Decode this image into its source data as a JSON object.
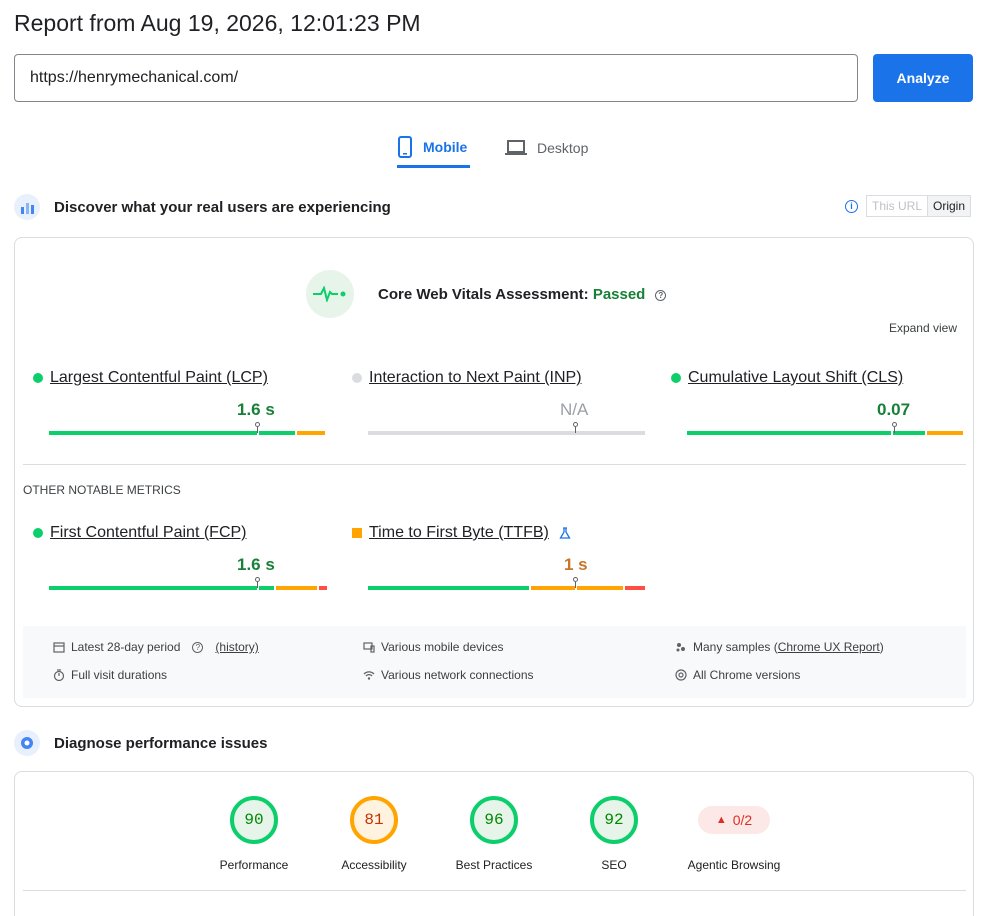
{
  "report_title": "Report from Aug 19, 2026, 12:01:23 PM",
  "url_input": {
    "value": "https://henrymechanical.com/"
  },
  "analyze_label": "Analyze",
  "tabs": [
    {
      "label": "Mobile",
      "active": true
    },
    {
      "label": "Desktop",
      "active": false
    }
  ],
  "field": {
    "heading": "Discover what your real users are experiencing",
    "toggle": {
      "this_url": "This URL",
      "origin": "Origin",
      "selected": "Origin"
    },
    "assessment_prefix": "Core Web Vitals Assessment:",
    "assessment_status": "Passed",
    "expand_view": "Expand view",
    "metrics": [
      {
        "name": "Largest Contentful Paint (LCP)",
        "value": "1.6 s",
        "status": "good"
      },
      {
        "name": "Interaction to Next Paint (INP)",
        "value": "N/A",
        "status": "none"
      },
      {
        "name": "Cumulative Layout Shift (CLS)",
        "value": "0.07",
        "status": "good"
      }
    ],
    "other_label": "OTHER NOTABLE METRICS",
    "other_metrics": [
      {
        "name": "First Contentful Paint (FCP)",
        "value": "1.6 s",
        "status": "good"
      },
      {
        "name": "Time to First Byte (TTFB)",
        "value": "1 s",
        "status": "average"
      }
    ],
    "info": {
      "period": "Latest 28-day period",
      "history": "(history)",
      "devices": "Various mobile devices",
      "samples_prefix": "Many samples (",
      "samples_link": "Chrome UX Report",
      "samples_suffix": ")",
      "durations": "Full visit durations",
      "network": "Various network connections",
      "chrome": "All Chrome versions"
    }
  },
  "diagnose": {
    "heading": "Diagnose performance issues",
    "scores": [
      {
        "label": "Performance",
        "value": "90",
        "level": "green"
      },
      {
        "label": "Accessibility",
        "value": "81",
        "level": "orange"
      },
      {
        "label": "Best Practices",
        "value": "96",
        "level": "green"
      },
      {
        "label": "SEO",
        "value": "92",
        "level": "green"
      },
      {
        "label": "Agentic Browsing",
        "value": "0/2",
        "level": "fail"
      }
    ]
  },
  "colors": {
    "accent": "#1a73e8",
    "good": "#0cce6b",
    "average": "#ffa400",
    "poor": "#ff4e42",
    "pass_text": "#188038"
  }
}
